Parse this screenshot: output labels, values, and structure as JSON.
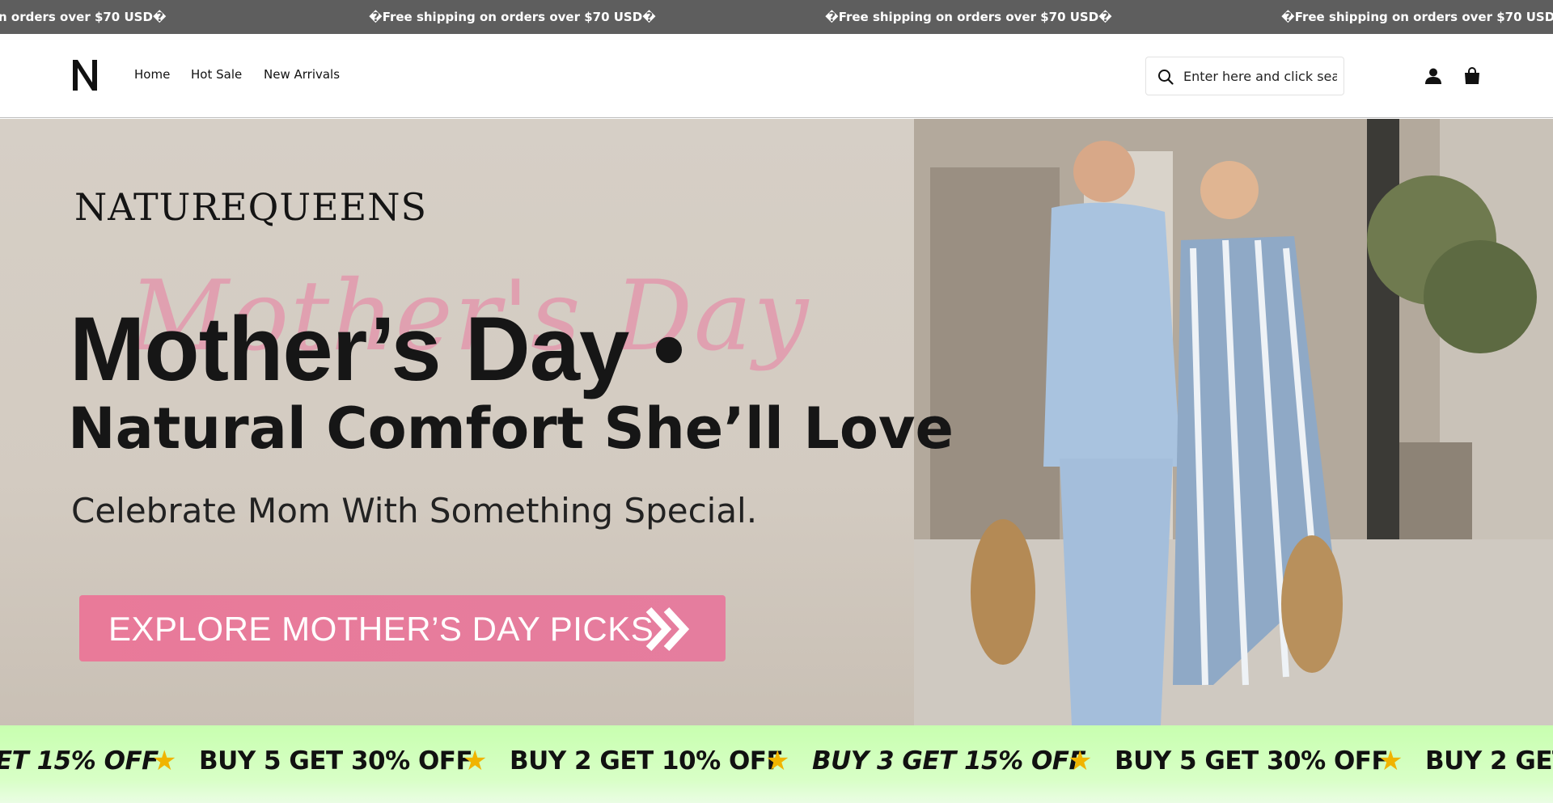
{
  "announcement": {
    "text_cut": "n orders over $70 USD�",
    "text": "�Free shipping on orders over $70 USD�"
  },
  "header": {
    "logo_letter": "N",
    "nav": [
      "Home",
      "Hot Sale",
      "New Arrivals"
    ],
    "search_placeholder": "Enter here and click search"
  },
  "hero": {
    "brand": "NATUREQUEENS",
    "script_text": "Mother's Day",
    "title": "Mother’s Day •",
    "subtitle": "Natural Comfort She’ll Love",
    "tagline": "Celebrate Mom With Something Special.",
    "cta": "EXPLORE MOTHER’S DAY PICKS"
  },
  "promo": {
    "items": [
      "ET 15% OFF",
      "BUY 5 GET 30% OFF",
      "BUY 2 GET 10% OFF",
      "BUY 3 GET 15% OFF",
      "BUY 5 GET 30% OFF",
      "BUY 2 GET"
    ],
    "star": "★"
  },
  "colors": {
    "announce_bg": "#5e5e5e",
    "cta_pink": "#e97a99",
    "promo_green": "#c8ffb0",
    "star": "#f0b400"
  }
}
